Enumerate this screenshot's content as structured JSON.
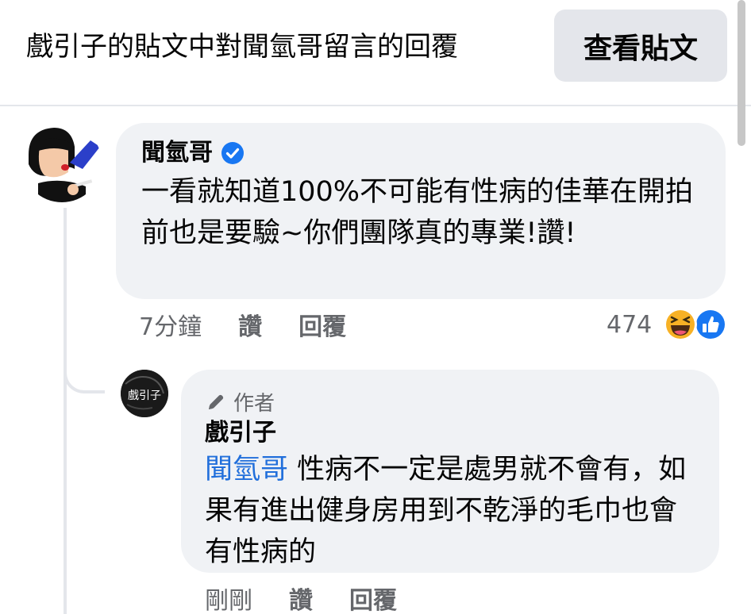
{
  "header": {
    "title": "戲引子的貼文中對聞氫哥留言的回覆",
    "view_post_label": "查看貼文"
  },
  "comment": {
    "author": "聞氫哥",
    "text": "一看就知道100%不可能有性病的佳華在開拍前也是要驗~你們團隊真的專業!讚!",
    "time": "7分鐘",
    "like_label": "讚",
    "reply_label": "回覆",
    "reaction_count": "474",
    "reactions": [
      "haha-icon",
      "like-icon"
    ],
    "verified": true
  },
  "reply": {
    "badge_label": "作者",
    "author": "戲引子",
    "mention": "聞氫哥",
    "text": " 性病不一定是處男就不會有，如果有進出健身房用到不乾淨的毛巾也會有性病的",
    "time": "剛剛",
    "like_label": "讚",
    "reply_label": "回覆",
    "avatar_text": "戲引子"
  },
  "colors": {
    "accent": "#216fdb",
    "bubble": "#f0f2f5",
    "secondary_text": "#65676b",
    "verified": "#1877f2"
  }
}
